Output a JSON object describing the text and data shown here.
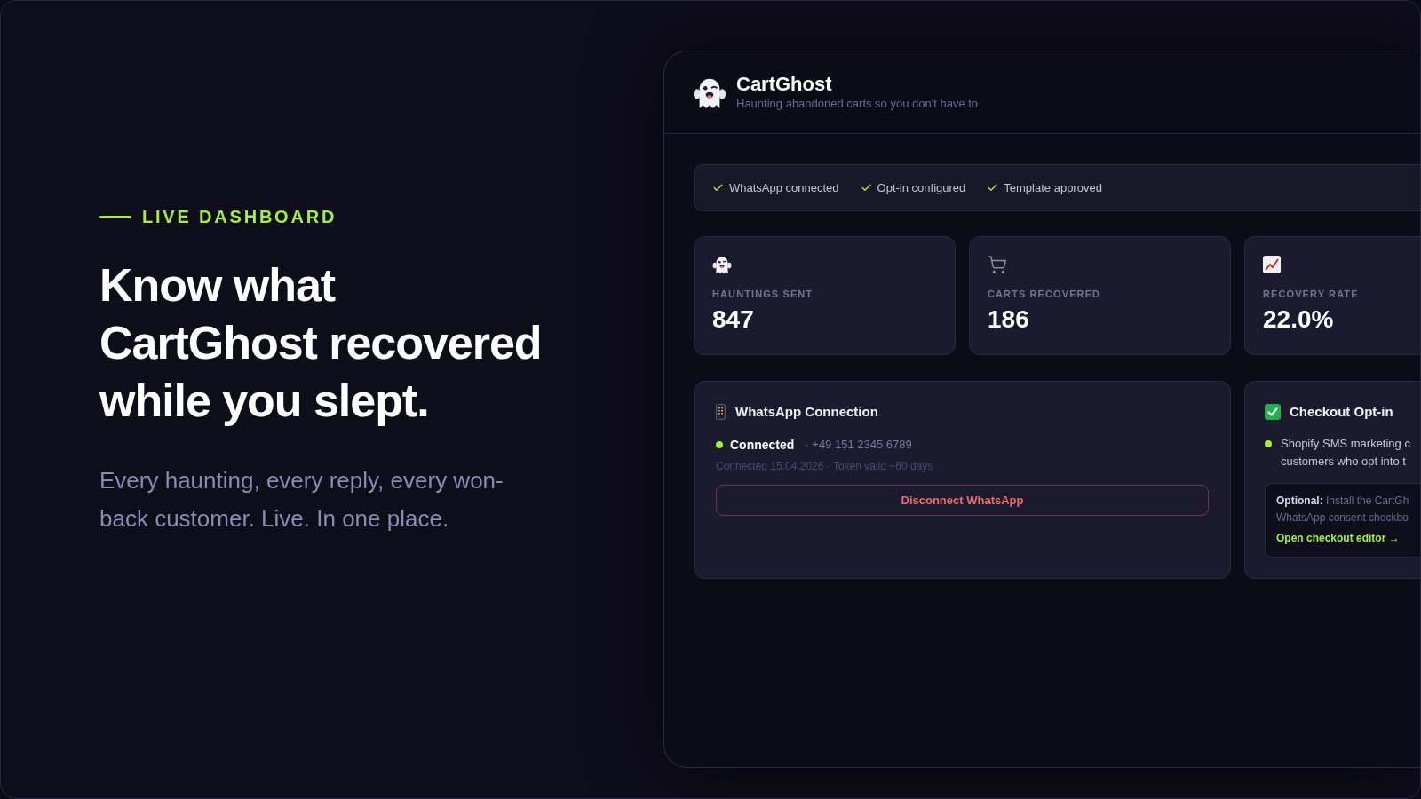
{
  "hero": {
    "eyebrow": "LIVE DASHBOARD",
    "headline": "Know what CartGhost recovered while you slept.",
    "body": "Every haunting, every reply, every won-back customer. Live. In one place."
  },
  "dashboard": {
    "app": {
      "name": "CartGhost",
      "tagline": "Haunting abandoned carts so you don't have to"
    },
    "checklist": [
      {
        "label": "WhatsApp connected",
        "checked": true
      },
      {
        "label": "Opt-in configured",
        "checked": true
      },
      {
        "label": "Template approved",
        "checked": true
      }
    ],
    "stats": [
      {
        "kind": "ghost",
        "label": "HAUNTINGS SENT",
        "value": "847"
      },
      {
        "kind": "cart",
        "label": "CARTS RECOVERED",
        "value": "186"
      },
      {
        "kind": "chart",
        "label": "RECOVERY RATE",
        "value": "22.0%"
      }
    ],
    "whatsapp_connection": {
      "title": "WhatsApp Connection",
      "status": "Connected",
      "connected": true,
      "phone": "· +49 151 2345 6789",
      "meta": "Connected 15.04.2026 · Token valid ~60 days",
      "button": "Disconnect WhatsApp"
    },
    "checkout_opt_in": {
      "title": "Checkout Opt-in",
      "active": true,
      "description_lines": [
        "Shopify SMS marketing c",
        "customers who opt into t"
      ],
      "note_lines": [
        "**Optional:** Install the CartGh",
        "WhatsApp consent checkbo"
      ],
      "link": "Open checkout editor →"
    }
  }
}
